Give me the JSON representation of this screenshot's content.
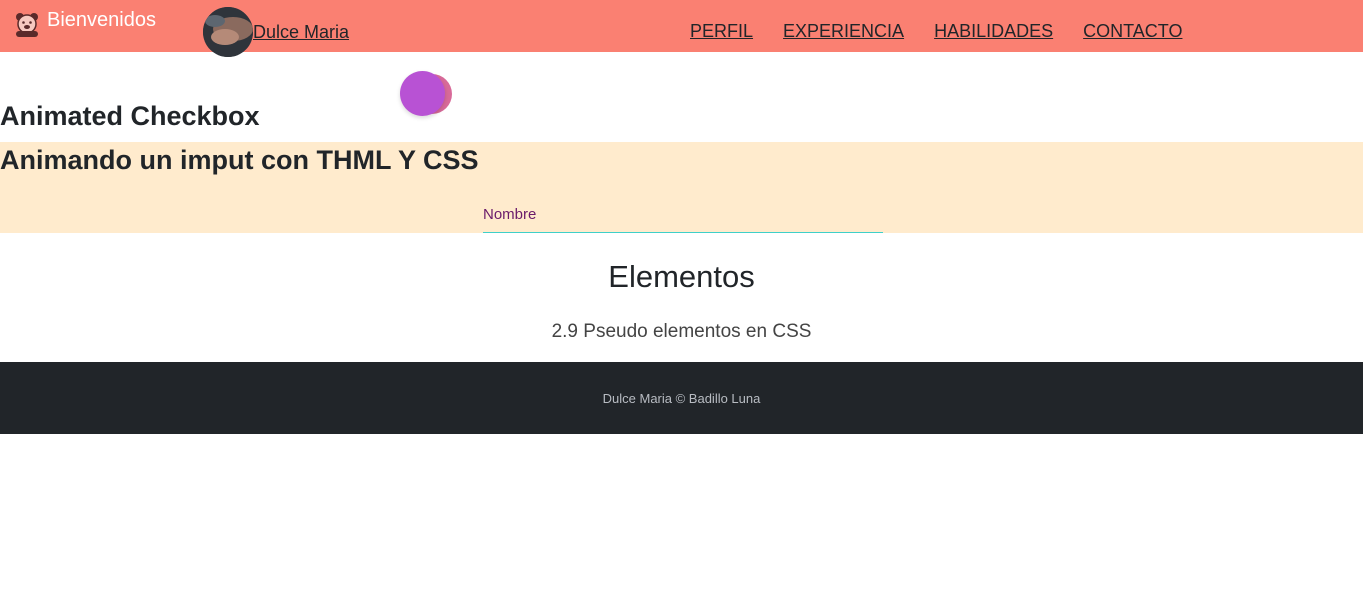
{
  "navbar": {
    "brand_text": "Bienvenidos",
    "brand_icon": "bear-icon",
    "profile_name": "Dulce Maria",
    "links": [
      "PERFIL",
      "EXPERIENCIA",
      "HABILIDADES",
      "CONTACTO"
    ],
    "background": "#fa8072"
  },
  "checkbox_section": {
    "title": "Animated Checkbox",
    "toggle_colors": [
      "#b852d4",
      "#d86a99"
    ]
  },
  "input_section": {
    "title": "Animando un imput con THML Y CSS",
    "field_label": "Nombre",
    "background": "#ffebcd"
  },
  "elementos": {
    "title": "Elementos",
    "subtitle": "2.9 Pseudo elementos en CSS"
  },
  "footer": {
    "text": "Dulce Maria © Badillo Luna",
    "background": "#212529"
  }
}
